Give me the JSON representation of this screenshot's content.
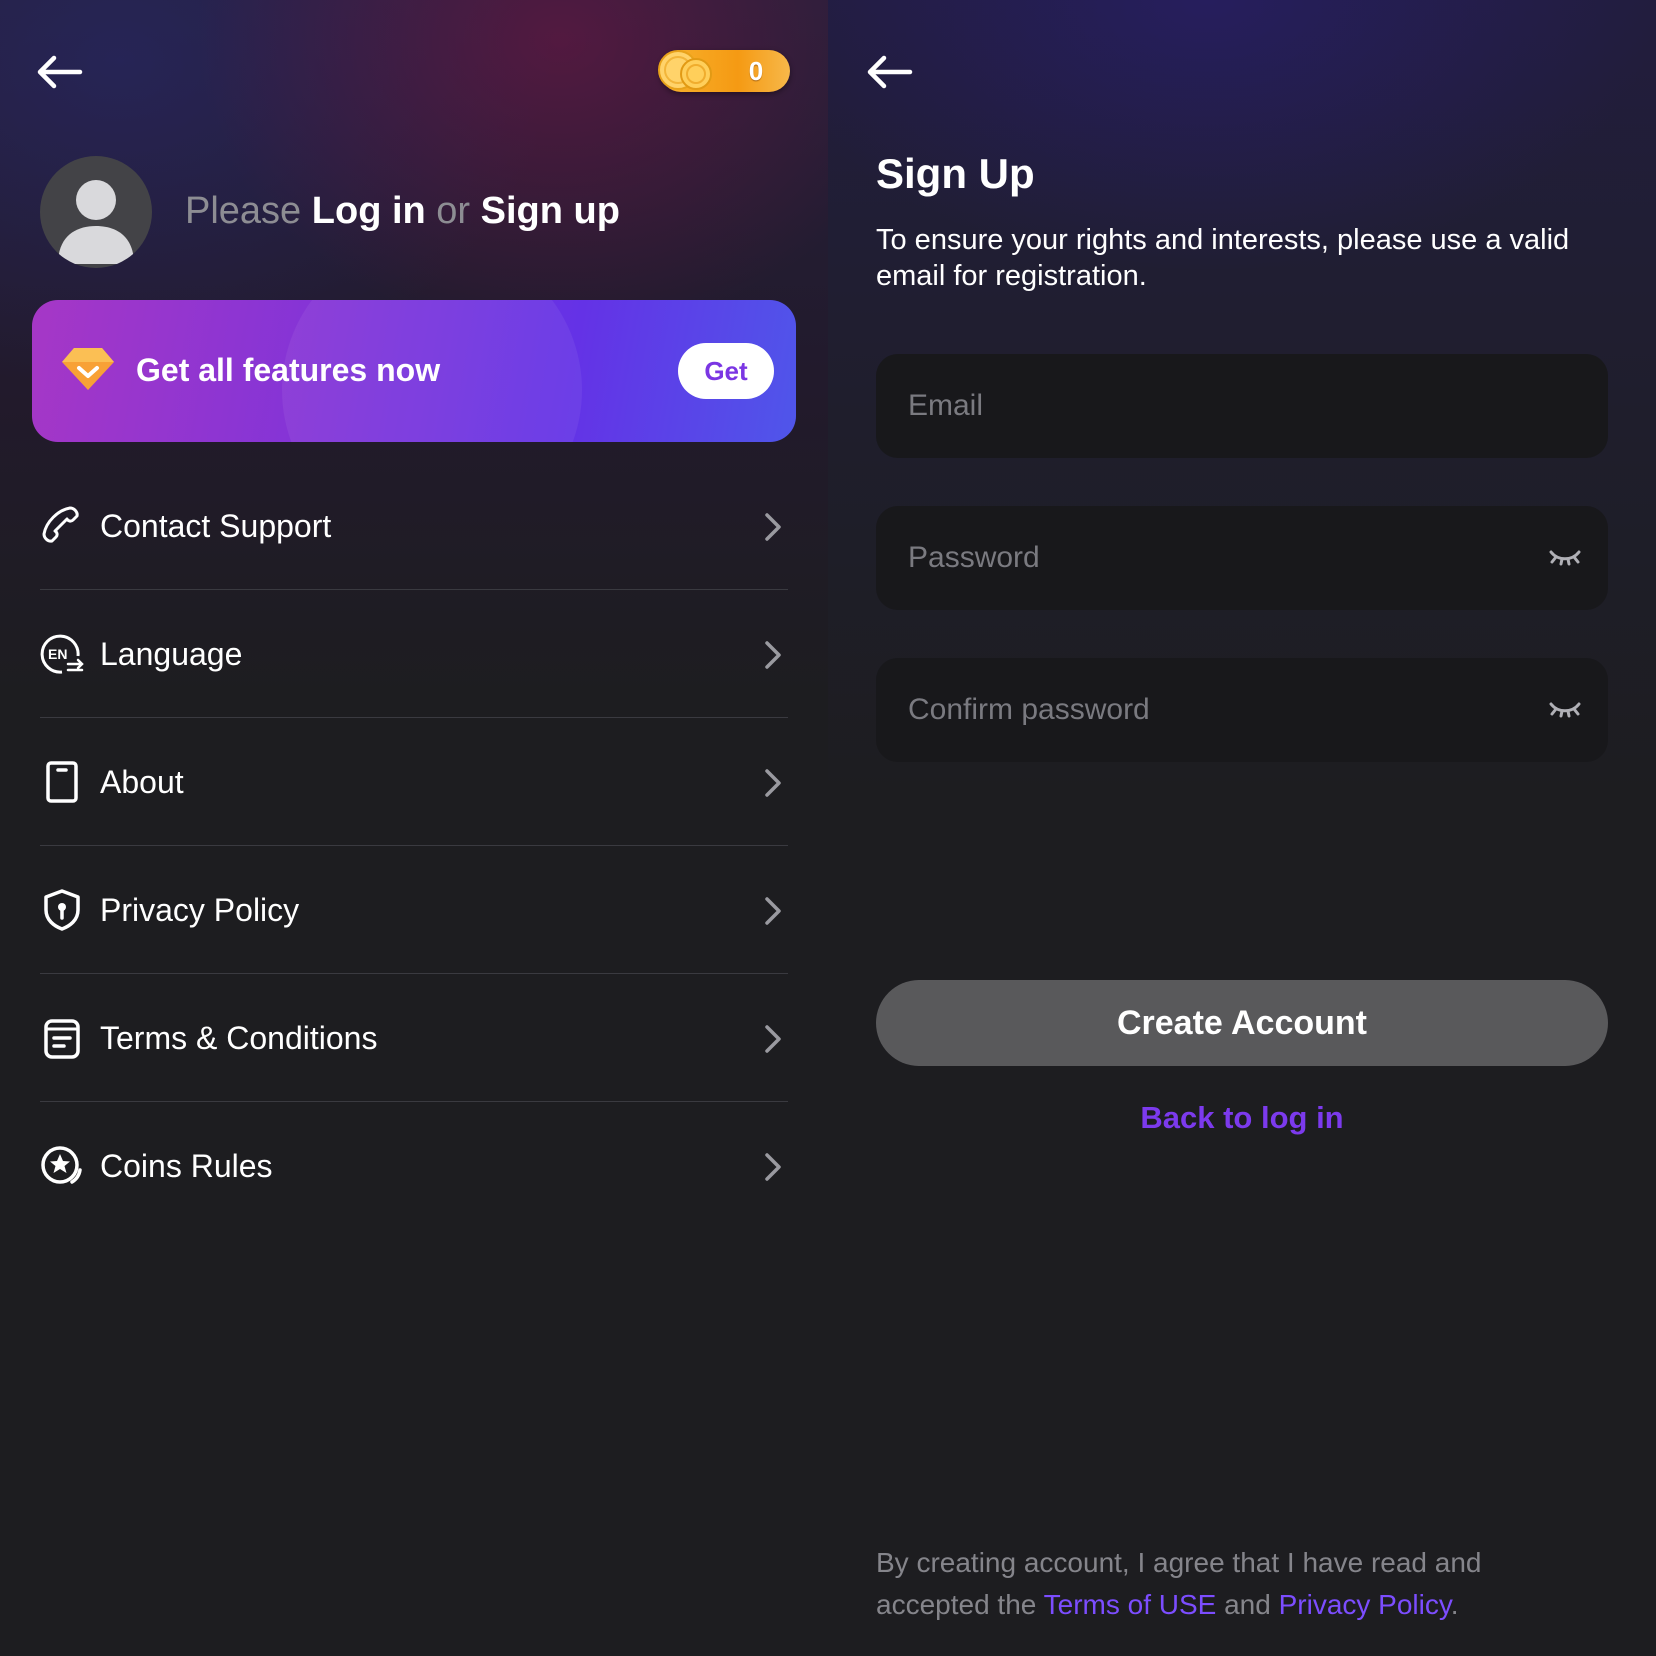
{
  "left_panel": {
    "coins": {
      "count": "0"
    },
    "profile": {
      "prefix": "Please",
      "login_link": "Log in",
      "connector": "or",
      "signup_link": "Sign up"
    },
    "premium": {
      "label": "Get all features now",
      "button": "Get"
    },
    "menu": [
      {
        "label": "Contact Support",
        "icon": "phone-icon"
      },
      {
        "label": "Language",
        "icon": "language-icon"
      },
      {
        "label": "About",
        "icon": "device-icon"
      },
      {
        "label": "Privacy Policy",
        "icon": "shield-icon"
      },
      {
        "label": "Terms & Conditions",
        "icon": "document-icon"
      },
      {
        "label": "Coins Rules",
        "icon": "coin-star-icon"
      }
    ]
  },
  "right_panel": {
    "title": "Sign Up",
    "subtitle": "To ensure your rights and interests, please use a valid email for registration.",
    "email": {
      "placeholder": "Email",
      "value": ""
    },
    "password": {
      "placeholder": "Password",
      "value": ""
    },
    "confirm_password": {
      "placeholder": "Confirm password",
      "value": ""
    },
    "create_button": "Create Account",
    "back_to_login": "Back to log in",
    "agreement": {
      "text_before": "By creating account, I agree that I have read and accepted the",
      "terms_link": "Terms of USE",
      "and": "and",
      "privacy_link": "Privacy Policy",
      "period": "."
    }
  },
  "colors": {
    "accent_purple": "#7c3aed",
    "coin_gold": "#f59a13",
    "field_bg": "#18181b",
    "button_grey": "#59595b"
  }
}
